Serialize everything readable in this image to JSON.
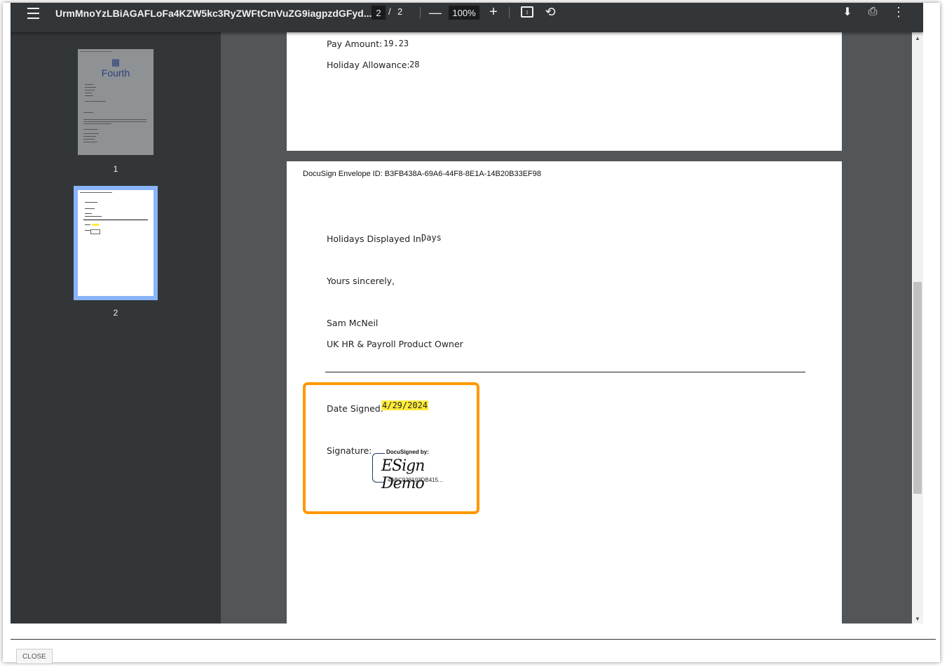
{
  "toolbar": {
    "title": "UrmMnoYzLBiAGAFLoFa4KZW5kc3RyZWFtCmVuZG9iagpzdGFyd...",
    "current_page": "2",
    "separator": "/",
    "total_pages": "2",
    "zoom": "100%"
  },
  "icons": {
    "menu": "menu-icon",
    "zoom_out": "minus-icon",
    "zoom_in": "plus-icon",
    "fit": "fit-to-page-icon",
    "rotate": "rotate-icon",
    "download": "download-icon",
    "print": "print-icon",
    "more": "more-vertical-icon"
  },
  "sidebar": {
    "thumbnails": [
      {
        "number": "1",
        "logo_text": "Fourth"
      },
      {
        "number": "2"
      }
    ]
  },
  "page1": {
    "pay_amount_label": "Pay Amount:",
    "pay_amount_value": "19.23",
    "holiday_allowance_label": "Holiday Allowance:",
    "holiday_allowance_value": "28"
  },
  "page2": {
    "envelope_id": "DocuSign Envelope ID: B3FB438A-69A6-44F8-8E1A-14B20B33EF98",
    "holidays_label": "Holidays Displayed In:",
    "holidays_value": "Days",
    "closing": "Yours sincerely,",
    "signer_name": "Sam McNeil",
    "signer_title": "UK HR & Payroll Product Owner",
    "date_signed_label": "Date Signed:",
    "date_signed_value": "4/29/2024",
    "signature_label": "Signature:",
    "signature": {
      "docusigned_by": "DocuSigned by:",
      "name": "ESign Demo",
      "id": "4ABC928193DB415..."
    }
  },
  "colors": {
    "highlight_box": "#ff9800",
    "date_highlight": "#ffeb3b",
    "toolbar_bg": "#323639",
    "viewer_bg": "#525659",
    "selected_thumb_border": "#8ab4f8"
  },
  "footer": {
    "close_label": "CLOSE"
  }
}
